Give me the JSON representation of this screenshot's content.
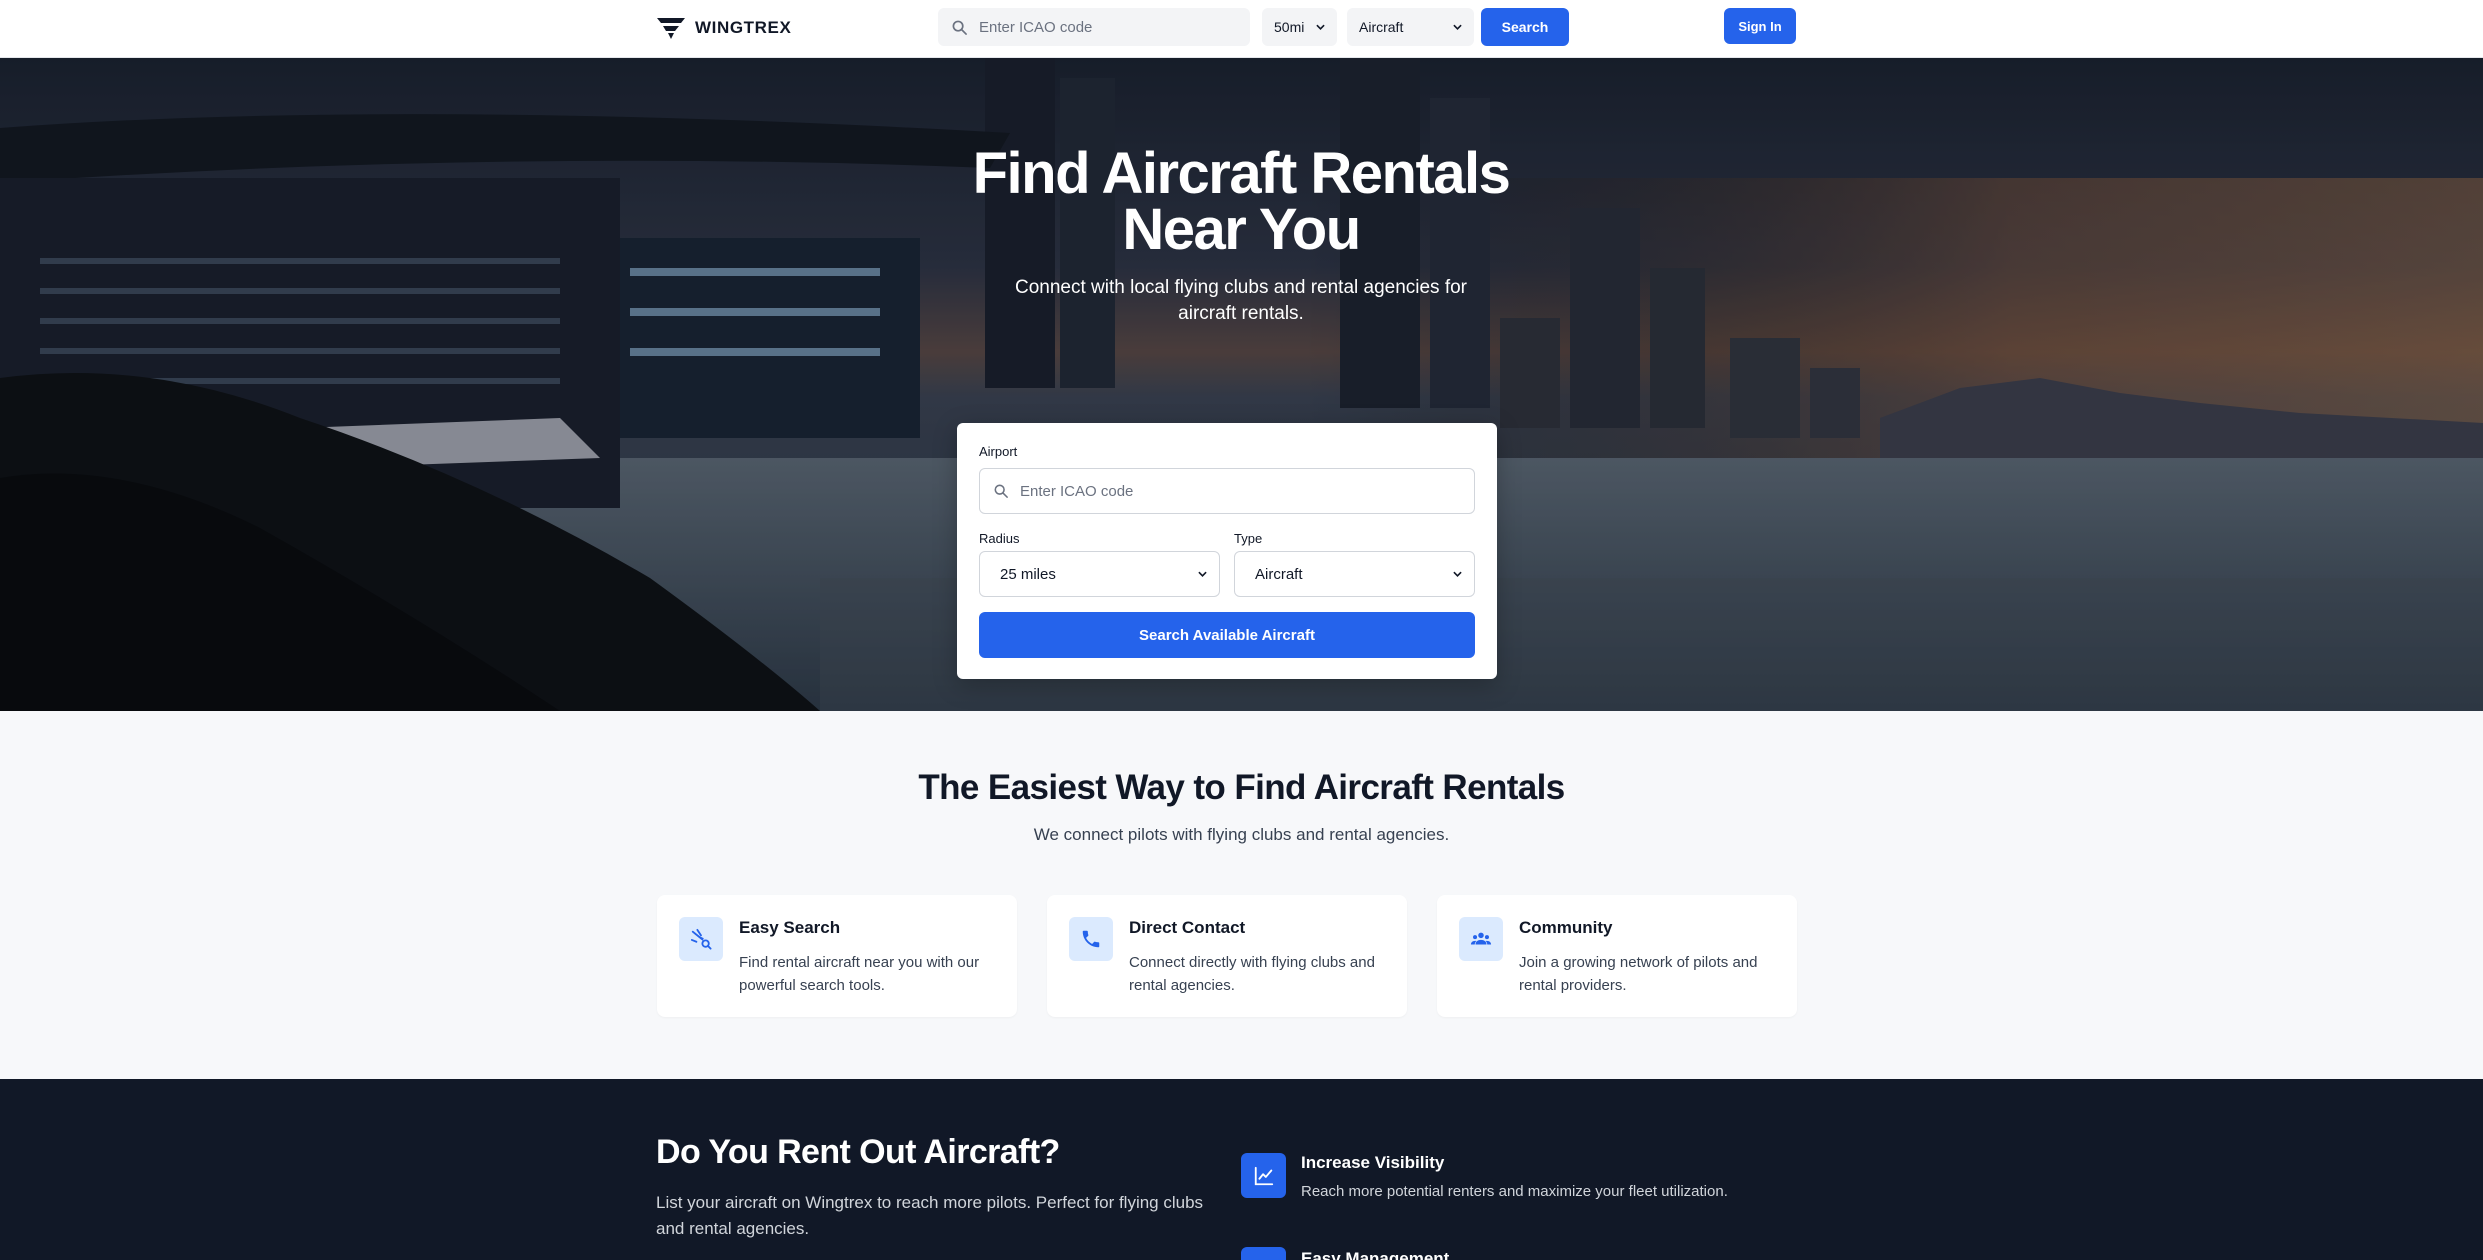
{
  "brand": {
    "name": "WINGTREX"
  },
  "nav": {
    "search_placeholder": "Enter ICAO code",
    "radius_value": "50mi",
    "type_value": "Aircraft",
    "search_label": "Search",
    "signin_label": "Sign In"
  },
  "hero": {
    "title": "Find Aircraft Rentals Near You",
    "subtitle": "Connect with local flying clubs and rental agencies for aircraft rentals.",
    "form": {
      "airport_label": "Airport",
      "airport_placeholder": "Enter ICAO code",
      "radius_label": "Radius",
      "radius_value": "25 miles",
      "type_label": "Type",
      "type_value": "Aircraft",
      "submit_label": "Search Available Aircraft"
    }
  },
  "features": {
    "title": "The Easiest Way to Find Aircraft Rentals",
    "subtitle": "We connect pilots with flying clubs and rental agencies.",
    "items": [
      {
        "icon": "plane-search-icon",
        "title": "Easy Search",
        "desc": "Find rental aircraft near you with our powerful search tools."
      },
      {
        "icon": "phone-icon",
        "title": "Direct Contact",
        "desc": "Connect directly with flying clubs and rental agencies."
      },
      {
        "icon": "group-icon",
        "title": "Community",
        "desc": "Join a growing network of pilots and rental providers."
      }
    ]
  },
  "owners": {
    "title": "Do You Rent Out Aircraft?",
    "subtitle": "List your aircraft on Wingtrex to reach more pilots. Perfect for flying clubs and rental agencies.",
    "benefits": [
      {
        "icon": "trend-chart-icon",
        "title": "Increase Visibility",
        "desc": "Reach more potential renters and maximize your fleet utilization."
      },
      {
        "icon": "manage-icon",
        "title": "Easy Management",
        "desc": ""
      }
    ]
  },
  "colors": {
    "accent": "#2563eb",
    "dark_section": "#111827",
    "icon_bg": "#dbeafe"
  }
}
